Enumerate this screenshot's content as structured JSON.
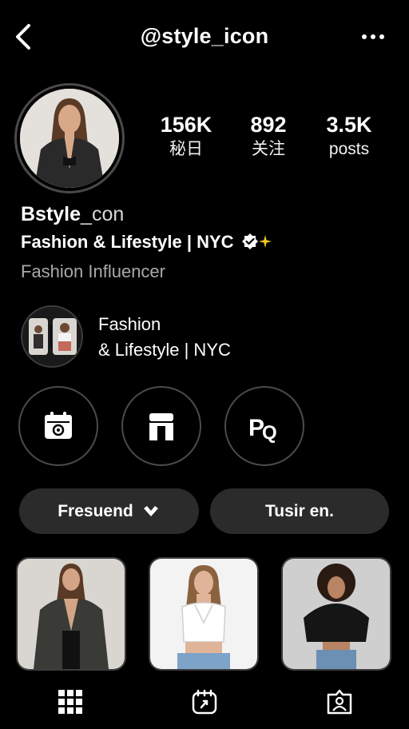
{
  "header": {
    "title": "@style_icon",
    "back_icon": "chevron-left-icon",
    "more_icon": "more-horizontal-icon"
  },
  "profile": {
    "stats": [
      {
        "value": "156K",
        "label": "秘日"
      },
      {
        "value": "892",
        "label": "关注"
      },
      {
        "value": "3.5K",
        "label": "posts"
      }
    ],
    "name_bold": "Bstyle",
    "name_light": "_con",
    "tagline": "Fashion & Lifestyle | NYC",
    "verified_icon": "verified-badge-icon",
    "category": "Fashion Influencer"
  },
  "featured": {
    "line1": "Fashion",
    "line2": "& Lifestyle | NYC"
  },
  "highlights": [
    {
      "icon": "calendar-icon"
    },
    {
      "icon": "storefront-icon"
    },
    {
      "icon": "pq-icon"
    }
  ],
  "actions": {
    "primary_label": "Fresuend",
    "primary_icon": "chevron-down-icon",
    "secondary_label": "Tusir en."
  },
  "tabs": [
    {
      "icon": "grid-icon"
    },
    {
      "icon": "reels-icon"
    },
    {
      "icon": "tagged-icon"
    }
  ],
  "colors": {
    "background": "#000000",
    "button": "#2b2b2b",
    "muted_text": "#a9a9a9",
    "accent_star": "#f3c623"
  }
}
